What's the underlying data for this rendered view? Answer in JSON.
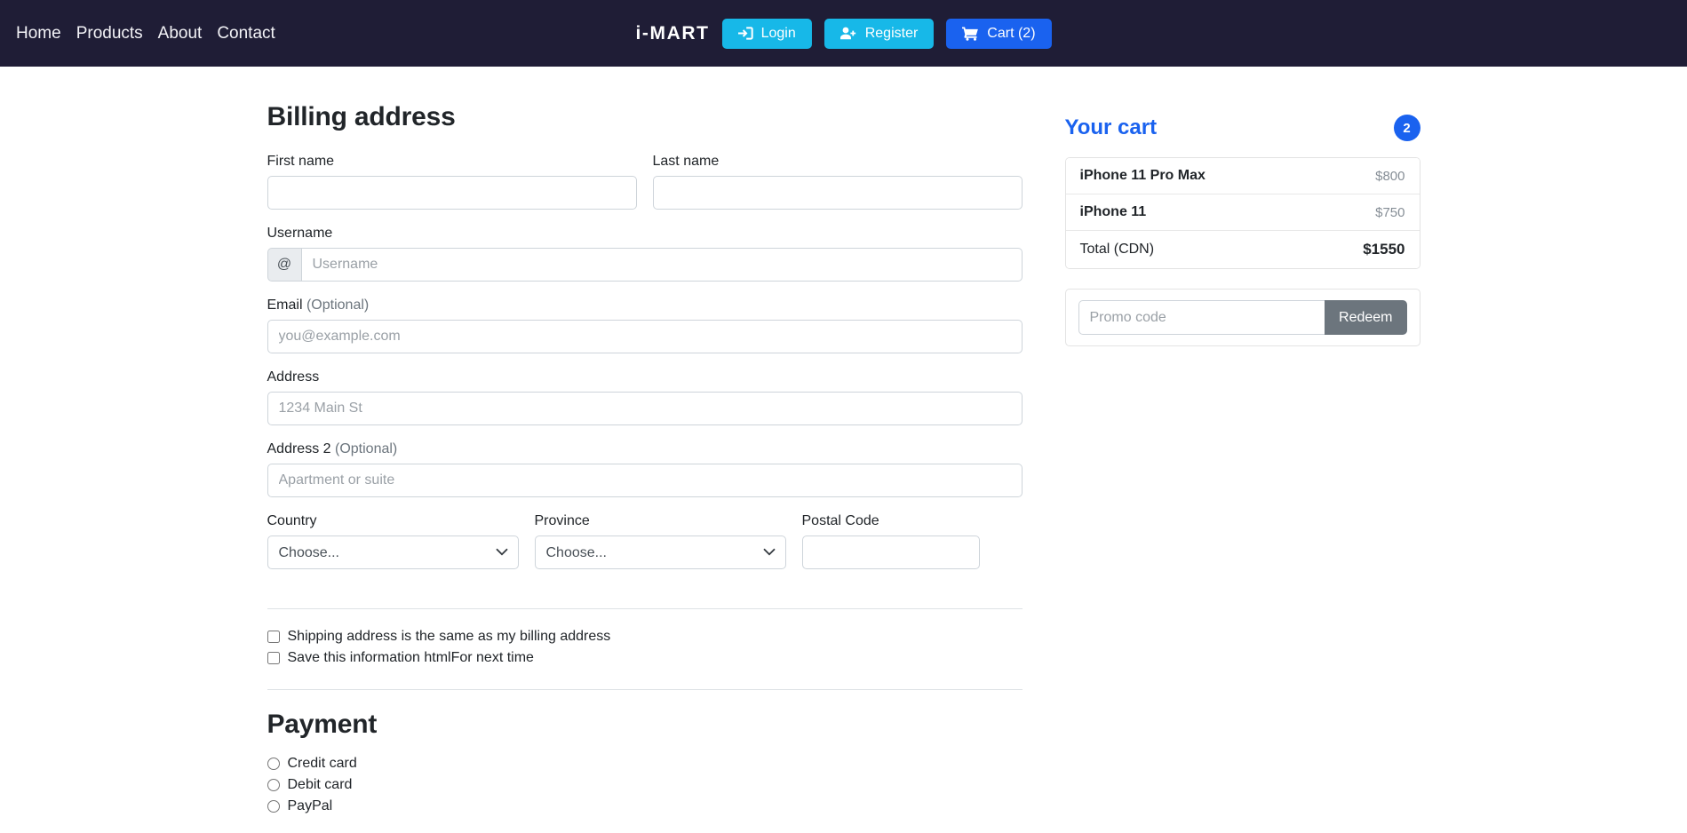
{
  "header": {
    "nav_links": [
      {
        "label": "Home"
      },
      {
        "label": "Products"
      },
      {
        "label": "About"
      },
      {
        "label": "Contact"
      }
    ],
    "brand": "i-MART",
    "login_label": "Login",
    "register_label": "Register",
    "cart_label": "Cart (2)",
    "colors": {
      "navbar_bg": "#1f1d36",
      "info": "#17b8e8",
      "primary": "#1a62ef"
    }
  },
  "billing": {
    "title": "Billing address",
    "first_name": {
      "label": "First name",
      "value": "",
      "placeholder": ""
    },
    "last_name": {
      "label": "Last name",
      "value": "",
      "placeholder": ""
    },
    "username": {
      "label": "Username",
      "prefix": "@",
      "value": "",
      "placeholder": "Username"
    },
    "email": {
      "label": "Email",
      "optional": "(Optional)",
      "value": "",
      "placeholder": "you@example.com"
    },
    "address": {
      "label": "Address",
      "value": "",
      "placeholder": "1234 Main St"
    },
    "address2": {
      "label": "Address 2",
      "optional": "(Optional)",
      "value": "",
      "placeholder": "Apartment or suite"
    },
    "country": {
      "label": "Country",
      "selected": "Choose...",
      "options": [
        "Choose..."
      ]
    },
    "province": {
      "label": "Province",
      "selected": "Choose...",
      "options": [
        "Choose..."
      ]
    },
    "postal_code": {
      "label": "Postal Code",
      "value": "",
      "placeholder": ""
    },
    "checkboxes": [
      {
        "label": "Shipping address is the same as my billing address",
        "checked": false
      },
      {
        "label": "Save this information htmlFor next time",
        "checked": false
      }
    ]
  },
  "payment": {
    "title": "Payment",
    "options": [
      {
        "label": "Credit card",
        "checked": false
      },
      {
        "label": "Debit card",
        "checked": false
      },
      {
        "label": "PayPal",
        "checked": false
      }
    ]
  },
  "cart": {
    "title": "Your cart",
    "badge": "2",
    "items": [
      {
        "name": "iPhone 11 Pro Max",
        "price": "$800"
      },
      {
        "name": "iPhone 11",
        "price": "$750"
      }
    ],
    "total": {
      "label": "Total (CDN)",
      "value": "$1550"
    },
    "promo": {
      "placeholder": "Promo code",
      "value": "",
      "redeem_label": "Redeem"
    }
  }
}
